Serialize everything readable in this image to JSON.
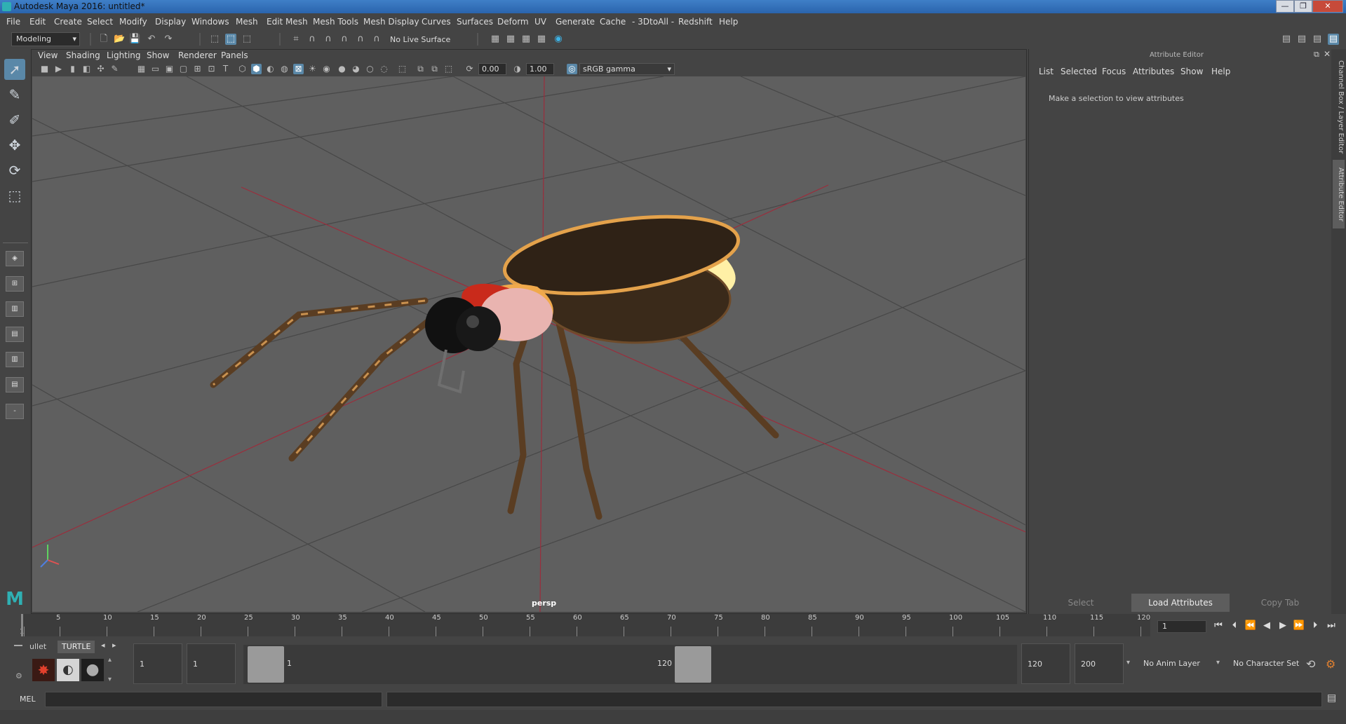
{
  "window": {
    "title": "Autodesk Maya 2016: untitled*",
    "controls": [
      "—",
      "❐",
      "✕"
    ]
  },
  "menus": [
    "File",
    "Edit",
    "Create",
    "Select",
    "Modify",
    "Display",
    "Windows",
    "Mesh",
    "Edit Mesh",
    "Mesh Tools",
    "Mesh Display",
    "Curves",
    "Surfaces",
    "Deform",
    "UV",
    "Generate",
    "Cache",
    "- 3DtoAll -",
    "Redshift",
    "Help"
  ],
  "statusline": {
    "menuset": "Modeling",
    "live_surface": "No Live Surface"
  },
  "viewport": {
    "menus": [
      "View",
      "Shading",
      "Lighting",
      "Show",
      "Renderer",
      "Panels"
    ],
    "exposure": "0.00",
    "gamma": "1.00",
    "colorspace": "sRGB gamma",
    "camera": "persp"
  },
  "attribute_editor": {
    "title": "Attribute Editor",
    "menus": [
      "List",
      "Selected",
      "Focus",
      "Attributes",
      "Show",
      "Help"
    ],
    "message": "Make a selection to view attributes",
    "buttons": {
      "select": "Select",
      "load": "Load Attributes",
      "copy": "Copy Tab"
    },
    "side_tabs": {
      "channel": "Channel Box / Layer Editor",
      "attr": "Attribute Editor"
    }
  },
  "time_slider": {
    "ticks": [
      "1",
      "5",
      "10",
      "15",
      "20",
      "25",
      "30",
      "35",
      "40",
      "45",
      "50",
      "55",
      "60",
      "65",
      "70",
      "75",
      "80",
      "85",
      "90",
      "95",
      "100",
      "105",
      "110",
      "115",
      "120"
    ],
    "current_frame": "1"
  },
  "range_slider": {
    "shelf_tabs": [
      "ullet",
      "TURTLE"
    ],
    "start_frame": "1",
    "playback_start": "1",
    "range_start": "1",
    "range_end": "120",
    "playback_end": "120",
    "end_frame": "200",
    "anim_layer": "No Anim Layer",
    "character_set": "No Character Set"
  },
  "command_line": {
    "label": "MEL"
  }
}
